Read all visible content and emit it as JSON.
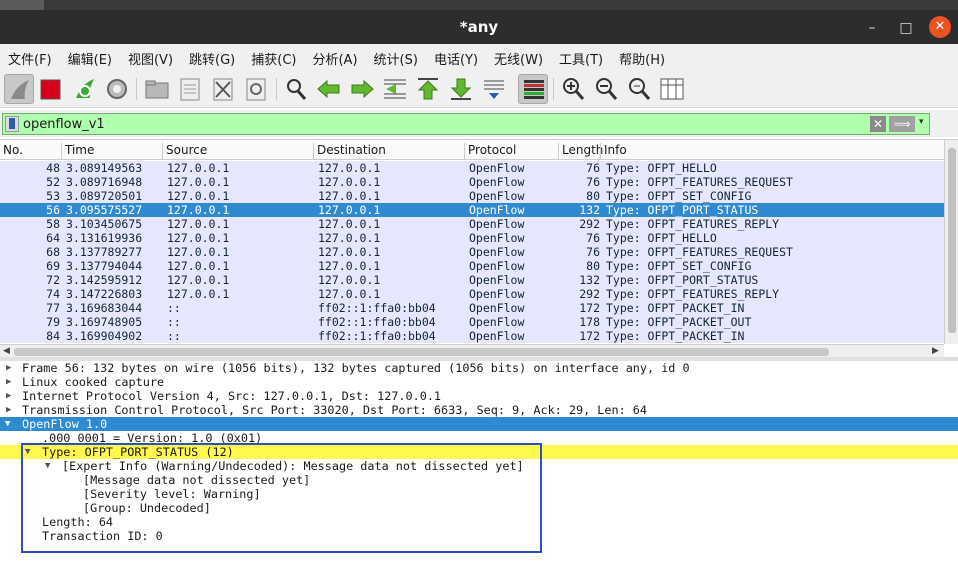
{
  "window": {
    "title": "*any",
    "min": "–",
    "max": "□",
    "close": "✕"
  },
  "menu": [
    "文件(F)",
    "编辑(E)",
    "视图(V)",
    "跳转(G)",
    "捕获(C)",
    "分析(A)",
    "统计(S)",
    "电话(Y)",
    "无线(W)",
    "工具(T)",
    "帮助(H)"
  ],
  "filter": {
    "value": "openflow_v1",
    "clear_icon": "✕",
    "apply_icon": "⟹",
    "dropdown_icon": "▾"
  },
  "columns": [
    "No.",
    "Time",
    "Source",
    "Destination",
    "Protocol",
    "Length",
    "Info"
  ],
  "packets": [
    {
      "no": "48",
      "time": "3.089149563",
      "src": "127.0.0.1",
      "dst": "127.0.0.1",
      "proto": "OpenFlow",
      "len": "76",
      "info": "Type: OFPT_HELLO"
    },
    {
      "no": "52",
      "time": "3.089716948",
      "src": "127.0.0.1",
      "dst": "127.0.0.1",
      "proto": "OpenFlow",
      "len": "76",
      "info": "Type: OFPT_FEATURES_REQUEST"
    },
    {
      "no": "53",
      "time": "3.089720501",
      "src": "127.0.0.1",
      "dst": "127.0.0.1",
      "proto": "OpenFlow",
      "len": "80",
      "info": "Type: OFPT_SET_CONFIG"
    },
    {
      "no": "56",
      "time": "3.095575527",
      "src": "127.0.0.1",
      "dst": "127.0.0.1",
      "proto": "OpenFlow",
      "len": "132",
      "info": "Type: OFPT_PORT_STATUS"
    },
    {
      "no": "58",
      "time": "3.103450675",
      "src": "127.0.0.1",
      "dst": "127.0.0.1",
      "proto": "OpenFlow",
      "len": "292",
      "info": "Type: OFPT_FEATURES_REPLY"
    },
    {
      "no": "64",
      "time": "3.131619936",
      "src": "127.0.0.1",
      "dst": "127.0.0.1",
      "proto": "OpenFlow",
      "len": "76",
      "info": "Type: OFPT_HELLO"
    },
    {
      "no": "68",
      "time": "3.137789277",
      "src": "127.0.0.1",
      "dst": "127.0.0.1",
      "proto": "OpenFlow",
      "len": "76",
      "info": "Type: OFPT_FEATURES_REQUEST"
    },
    {
      "no": "69",
      "time": "3.137794044",
      "src": "127.0.0.1",
      "dst": "127.0.0.1",
      "proto": "OpenFlow",
      "len": "80",
      "info": "Type: OFPT_SET_CONFIG"
    },
    {
      "no": "72",
      "time": "3.142595912",
      "src": "127.0.0.1",
      "dst": "127.0.0.1",
      "proto": "OpenFlow",
      "len": "132",
      "info": "Type: OFPT_PORT_STATUS"
    },
    {
      "no": "74",
      "time": "3.147226803",
      "src": "127.0.0.1",
      "dst": "127.0.0.1",
      "proto": "OpenFlow",
      "len": "292",
      "info": "Type: OFPT_FEATURES_REPLY"
    },
    {
      "no": "77",
      "time": "3.169683044",
      "src": "::",
      "dst": "ff02::1:ffa0:bb04",
      "proto": "OpenFlow",
      "len": "172",
      "info": "Type: OFPT_PACKET_IN"
    },
    {
      "no": "79",
      "time": "3.169748905",
      "src": "::",
      "dst": "ff02::1:ffa0:bb04",
      "proto": "OpenFlow",
      "len": "178",
      "info": "Type: OFPT_PACKET_OUT"
    },
    {
      "no": "84",
      "time": "3.169904902",
      "src": "::",
      "dst": "ff02::1:ffa0:bb04",
      "proto": "OpenFlow",
      "len": "172",
      "info": "Type: OFPT_PACKET_IN"
    }
  ],
  "details": {
    "frame": "Frame 56: 132 bytes on wire (1056 bits), 132 bytes captured (1056 bits) on interface any, id 0",
    "sll": "Linux cooked capture",
    "ip": "Internet Protocol Version 4, Src: 127.0.0.1, Dst: 127.0.0.1",
    "tcp": "Transmission Control Protocol, Src Port: 33020, Dst Port: 6633, Seq: 9, Ack: 29, Len: 64",
    "openflow": "OpenFlow 1.0",
    "version": ".000 0001 = Version: 1.0 (0x01)",
    "type": "Type: OFPT_PORT_STATUS (12)",
    "expert": "[Expert Info (Warning/Undecoded): Message data not dissected yet]",
    "expert_msg": "[Message data not dissected yet]",
    "severity": "[Severity level: Warning]",
    "group": "[Group: Undecoded]",
    "length": "Length: 64",
    "xid": "Transaction ID: 0"
  },
  "colors": {
    "row_bg": "#e7e6ff",
    "selected": "#308ad0",
    "filter_ok": "#afffaf",
    "warning": "#fff94d",
    "callout": "#2d4fc4"
  }
}
